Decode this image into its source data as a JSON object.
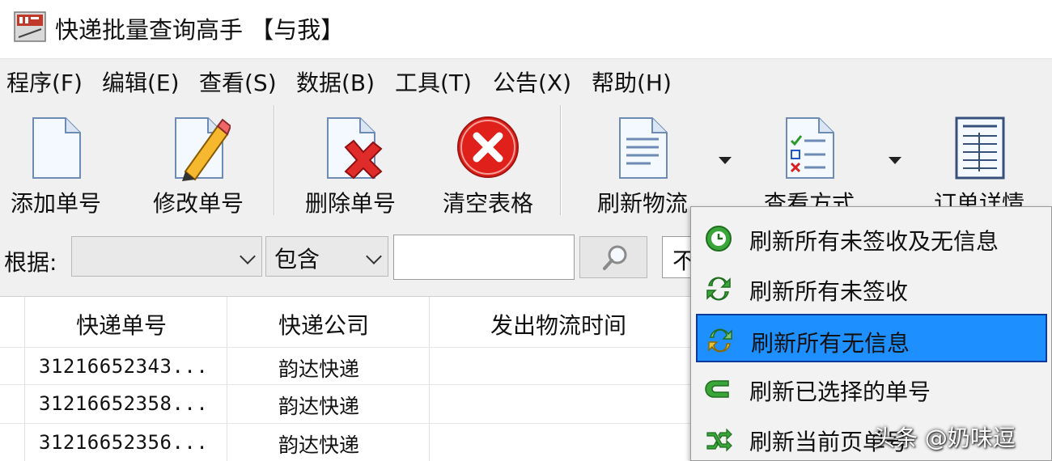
{
  "window": {
    "title": "快递批量查询高手 【与我】"
  },
  "menubar": {
    "items": [
      {
        "label": "程序(F)"
      },
      {
        "label": "编辑(E)"
      },
      {
        "label": "查看(S)"
      },
      {
        "label": "数据(B)"
      },
      {
        "label": "工具(T)"
      },
      {
        "label": "公告(X)"
      },
      {
        "label": "帮助(H)"
      }
    ]
  },
  "toolbar": {
    "add": "添加单号",
    "edit": "修改单号",
    "delete": "删除单号",
    "clear": "清空表格",
    "refresh": "刷新物流",
    "view_mode": "查看方式",
    "order_detail": "订单详情"
  },
  "filter": {
    "label": "根据:",
    "field_value": "",
    "operator_value": "包含",
    "text_value": "",
    "extra_combo_value": "不"
  },
  "grid": {
    "columns": [
      "快递单号",
      "快递公司",
      "发出物流时间"
    ],
    "rows": [
      {
        "tracking_no": "31216652343...",
        "company": "韵达快递"
      },
      {
        "tracking_no": "31216652358...",
        "company": "韵达快递"
      },
      {
        "tracking_no": "31216652356...",
        "company": "韵达快递"
      }
    ]
  },
  "refresh_menu": {
    "items": [
      {
        "label": "刷新所有未签收及无信息",
        "icon": "refresh-clock-icon",
        "selected": false
      },
      {
        "label": "刷新所有未签收",
        "icon": "refresh-arrows-icon",
        "selected": false
      },
      {
        "label": "刷新所有无信息",
        "icon": "refresh-info-icon",
        "selected": true
      },
      {
        "label": "刷新已选择的单号",
        "icon": "refresh-selected-icon",
        "selected": false
      },
      {
        "label": "刷新当前页单号",
        "icon": "refresh-page-icon",
        "selected": false
      }
    ]
  },
  "watermark": "头条 @奶味逗",
  "colors": {
    "menu_bg": "#f0f0f0",
    "selection": "#1e8fff",
    "selection_border": "#0b3a9b",
    "clear_red": "#e0201a"
  }
}
